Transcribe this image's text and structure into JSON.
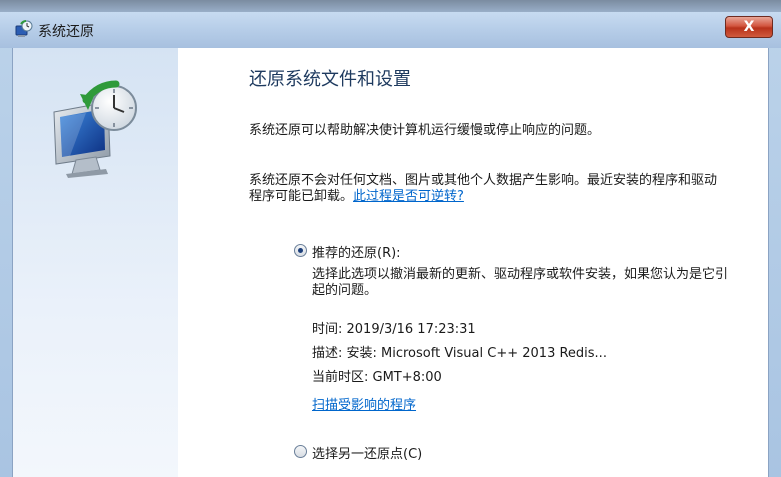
{
  "window": {
    "title": "系统还原",
    "close_label": "X"
  },
  "icons": {
    "app": "system-restore-icon",
    "hero": "system-restore-monitor-clock-icon"
  },
  "main": {
    "heading": "还原系统文件和设置",
    "para1": "系统还原可以帮助解决使计算机运行缓慢或停止响应的问题。",
    "para2_text": "系统还原不会对任何文档、图片或其他个人数据产生影响。最近安装的程序和驱动程序可能已卸载。",
    "para2_link": "此过程是否可逆转?"
  },
  "recommended": {
    "label": "推荐的还原(R):",
    "selected": true,
    "description": "选择此选项以撤消最新的更新、驱动程序或软件安装，如果您认为是它引起的问题。",
    "time": "时间: 2019/3/16 17:23:31",
    "desc": "描述: 安装: Microsoft Visual C++ 2013 Redis...",
    "timezone": "当前时区: GMT+8:00",
    "scan_link": "扫描受影响的程序"
  },
  "alternate": {
    "label": "选择另一还原点(C)",
    "selected": false
  },
  "colors": {
    "link": "#0066cc",
    "heading": "#1e3a5f",
    "close": "#c7452a"
  }
}
